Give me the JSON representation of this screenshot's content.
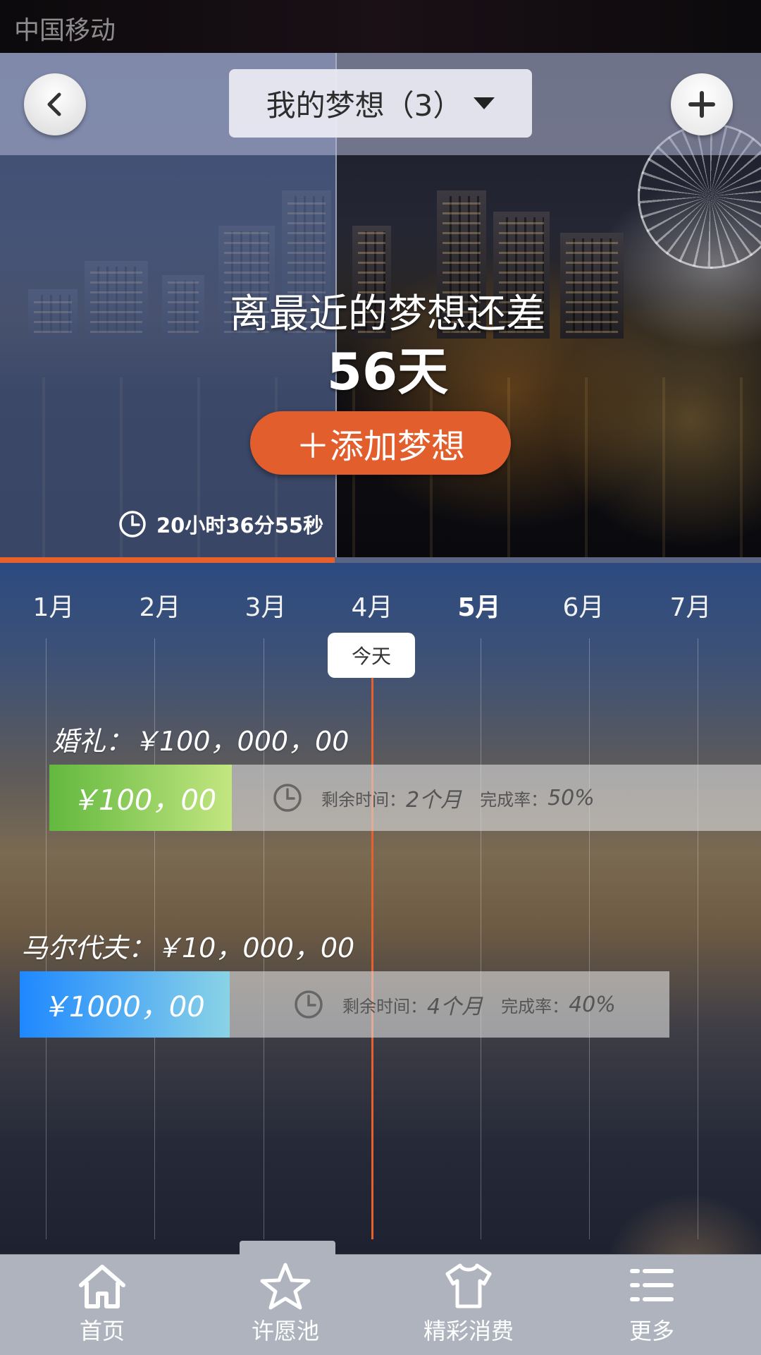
{
  "status_bar": {
    "carrier": "中国移动"
  },
  "header": {
    "dream_selector": "我的梦想（3）"
  },
  "hero": {
    "headline": "离最近的梦想还差",
    "days": "56天",
    "add_button": "＋添加梦想",
    "countdown": "20小时36分55秒",
    "progress": 0.44
  },
  "timeline": {
    "months": [
      "1月",
      "2月",
      "3月",
      "4月",
      "5月",
      "6月",
      "7月"
    ],
    "current_month": "5月",
    "today_label": "今天",
    "dreams": [
      {
        "title": "婚礼：￥100，000，00",
        "saved": "￥100，00",
        "remaining_label": "剩余时间：",
        "remaining": "2个月",
        "rate_label": "完成率：",
        "rate": "50%",
        "color_from": "#62b83f",
        "color_to": "#c3e680"
      },
      {
        "title": "马尔代夫：￥10，000，00",
        "saved": "￥1000，00",
        "remaining_label": "剩余时间：",
        "remaining": "4个月",
        "rate_label": "完成率：",
        "rate": "40%",
        "color_from": "#1e88ff",
        "color_to": "#8ad3e6"
      }
    ]
  },
  "nav": {
    "items": [
      {
        "label": "首页",
        "icon": "home-icon"
      },
      {
        "label": "许愿池",
        "icon": "star-icon"
      },
      {
        "label": "精彩消费",
        "icon": "tshirt-icon"
      },
      {
        "label": "更多",
        "icon": "menu-icon"
      }
    ],
    "active_index": 1
  },
  "colors": {
    "accent": "#e8602c",
    "green_bar": "#62b83f",
    "blue_bar": "#1e88ff"
  }
}
